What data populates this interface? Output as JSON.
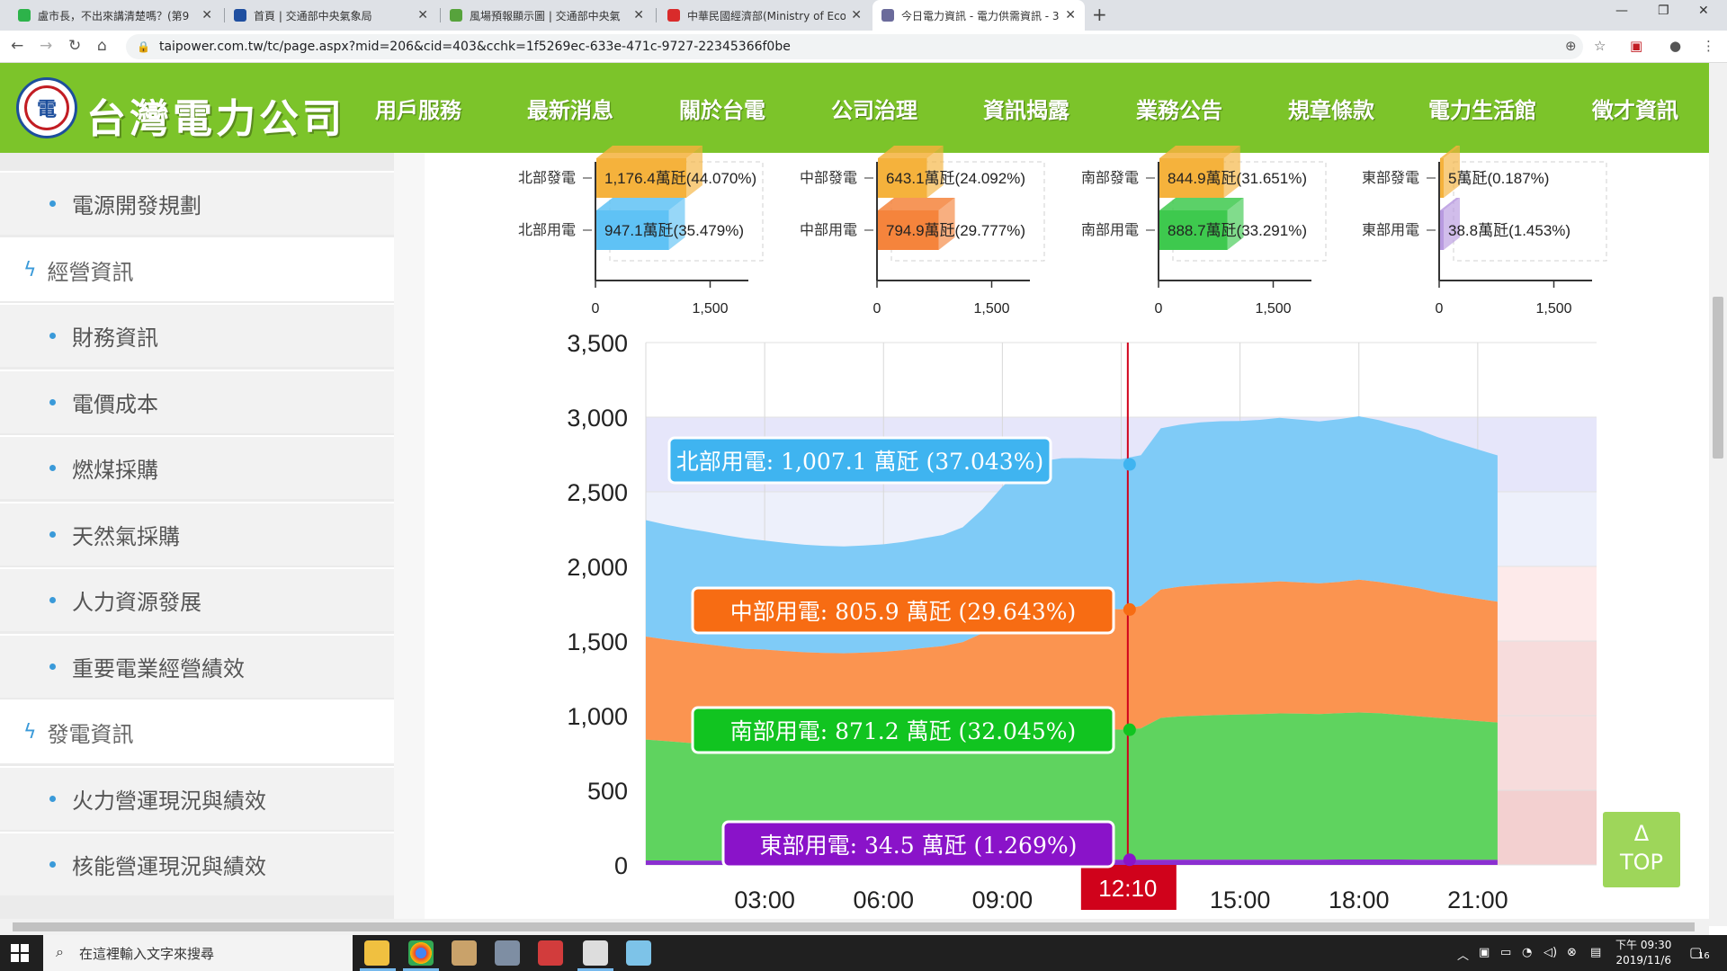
{
  "browser": {
    "tabs": [
      {
        "title": "盧市長，不出來講清楚嗎？(第9",
        "color": "#2db34a",
        "active": false
      },
      {
        "title": "首頁 | 交通部中央氣象局",
        "color": "#1f4fa0",
        "active": false
      },
      {
        "title": "風場預報顯示圖 | 交通部中央氣",
        "color": "#57a33c",
        "active": false
      },
      {
        "title": "中華民國經濟部(Ministry of Eco",
        "color": "#d92b2b",
        "active": false
      },
      {
        "title": "今日電力資訊 - 電力供需資訊 - 3",
        "color": "#6b6b9b",
        "active": true
      }
    ],
    "new_tab": "+",
    "close": "✕",
    "url": "taipower.com.tw/tc/page.aspx?mid=206&cid=403&cchk=1f5269ec-633e-471c-9727-22345366f0be"
  },
  "site": {
    "brand": "台灣電力公司",
    "nav": [
      "用戶服務",
      "最新消息",
      "關於台電",
      "公司治理",
      "資訊揭露",
      "業務公告",
      "規章條款",
      "電力生活館",
      "徵才資訊"
    ]
  },
  "sidebar": {
    "items": [
      {
        "label": "電源開發規劃",
        "type": "sub"
      },
      {
        "label": "經營資訊",
        "type": "section"
      },
      {
        "label": "財務資訊",
        "type": "sub"
      },
      {
        "label": "電價成本",
        "type": "sub"
      },
      {
        "label": "燃煤採購",
        "type": "sub"
      },
      {
        "label": "天然氣採購",
        "type": "sub"
      },
      {
        "label": "人力資源發展",
        "type": "sub"
      },
      {
        "label": "重要電業經營績效",
        "type": "sub"
      },
      {
        "label": "發電資訊",
        "type": "section"
      },
      {
        "label": "火力營運現況與績效",
        "type": "sub"
      },
      {
        "label": "核能營運現況與績效",
        "type": "sub"
      }
    ]
  },
  "chart_data": [
    {
      "type": "bar",
      "panels": [
        {
          "labels": [
            "北部發電",
            "北部用電"
          ],
          "values": [
            1176.4,
            947.1
          ],
          "texts": [
            "1,176.4萬瓩(44.070%)",
            "947.1萬瓩(35.479%)"
          ],
          "colors": [
            "#f5b23c",
            "#5fc2f5"
          ]
        },
        {
          "labels": [
            "中部發電",
            "中部用電"
          ],
          "values": [
            643.1,
            794.9
          ],
          "texts": [
            "643.1萬瓩(24.092%)",
            "794.9萬瓩(29.777%)"
          ],
          "colors": [
            "#f5b23c",
            "#f5843c"
          ]
        },
        {
          "labels": [
            "南部發電",
            "南部用電"
          ],
          "values": [
            844.9,
            888.7
          ],
          "texts": [
            "844.9萬瓩(31.651%)",
            "888.7萬瓩(33.291%)"
          ],
          "colors": [
            "#f5b23c",
            "#3ec94e"
          ]
        },
        {
          "labels": [
            "東部發電",
            "東部用電"
          ],
          "values": [
            5,
            38.8
          ],
          "texts": [
            "5萬瓩(0.187%)",
            "38.8萬瓩(1.453%)"
          ],
          "colors": [
            "#f5b23c",
            "#b89ae0"
          ]
        }
      ],
      "xlim": [
        0,
        2000
      ],
      "ticks": [
        0,
        1500
      ],
      "tick_labels": [
        "0",
        "1,500"
      ]
    },
    {
      "type": "area",
      "stacked": true,
      "ylim": [
        0,
        3500
      ],
      "yticks": [
        0,
        500,
        1000,
        1500,
        2000,
        2500,
        3000,
        3500
      ],
      "ytick_labels": [
        "0",
        "500",
        "1,000",
        "1,500",
        "2,000",
        "2,500",
        "3,000",
        "3,500"
      ],
      "xlim": [
        0,
        24
      ],
      "xticks": [
        3,
        6,
        9,
        15,
        18,
        21
      ],
      "xtick_labels": [
        "03:00",
        "06:00",
        "09:00",
        "15:00",
        "18:00",
        "21:00"
      ],
      "current_time": "12:10",
      "current_x": 12.1667,
      "bands": [
        {
          "from": 3000,
          "to": 3500,
          "color": "#ffffff"
        },
        {
          "from": 2500,
          "to": 3000,
          "color": "#e6e6fa"
        },
        {
          "from": 2000,
          "to": 2500,
          "color": "#edf0fb"
        },
        {
          "from": 1500,
          "to": 2000,
          "color": "#fdeaea"
        },
        {
          "from": 500,
          "to": 1500,
          "color": "#f7dcdc"
        },
        {
          "from": 0,
          "to": 500,
          "color": "#f3d0d0"
        }
      ],
      "x": [
        0,
        0.5,
        1,
        1.5,
        2,
        2.5,
        3,
        3.5,
        4,
        4.5,
        5,
        5.5,
        6,
        6.5,
        7,
        7.5,
        8,
        8.5,
        9,
        9.5,
        10,
        10.5,
        11,
        11.5,
        12,
        12.5,
        13,
        13.5,
        14,
        14.5,
        15,
        15.5,
        16,
        16.5,
        17,
        17.5,
        18,
        18.5,
        19,
        19.5,
        20,
        20.5,
        21,
        21.5
      ],
      "series": [
        {
          "name": "東部用電",
          "color": "#8b2fd0",
          "values": [
            30,
            30,
            29,
            29,
            29,
            28,
            28,
            28,
            28,
            28,
            28,
            28,
            28,
            29,
            30,
            31,
            32,
            33,
            34,
            34,
            35,
            35,
            35,
            35,
            35,
            35,
            35,
            35,
            35,
            35,
            35,
            35,
            35,
            35,
            35,
            36,
            36,
            36,
            36,
            35,
            35,
            35,
            34,
            34
          ]
        },
        {
          "name": "南部用電",
          "color": "#5fd35f",
          "values": [
            810,
            800,
            790,
            780,
            770,
            760,
            755,
            750,
            745,
            742,
            740,
            742,
            745,
            750,
            755,
            760,
            770,
            800,
            840,
            870,
            880,
            885,
            880,
            875,
            871,
            880,
            950,
            960,
            965,
            970,
            972,
            975,
            980,
            978,
            975,
            980,
            985,
            980,
            970,
            960,
            950,
            940,
            930,
            920
          ]
        },
        {
          "name": "中部用電",
          "color": "#fb9450",
          "values": [
            690,
            680,
            675,
            670,
            665,
            660,
            660,
            655,
            652,
            650,
            650,
            652,
            655,
            660,
            668,
            675,
            690,
            720,
            760,
            790,
            800,
            805,
            806,
            806,
            806,
            820,
            860,
            870,
            875,
            878,
            880,
            882,
            885,
            880,
            876,
            880,
            890,
            880,
            870,
            860,
            840,
            830,
            820,
            810
          ]
        },
        {
          "name": "北部用電",
          "color": "#7fcbf7",
          "values": [
            780,
            770,
            760,
            755,
            745,
            740,
            730,
            725,
            720,
            718,
            716,
            718,
            720,
            725,
            735,
            745,
            770,
            830,
            900,
            960,
            990,
            1000,
            1005,
            1006,
            1007,
            1010,
            1080,
            1085,
            1090,
            1090,
            1088,
            1090,
            1095,
            1090,
            1085,
            1090,
            1095,
            1085,
            1070,
            1060,
            1040,
            1020,
            1000,
            980
          ]
        }
      ],
      "tooltips": [
        {
          "text": "北部用電: 1,007.1 萬瓩 (37.043%)",
          "value": 2683.7,
          "color": "#3fb4f0"
        },
        {
          "text": "中部用電: 805.9 萬瓩 (29.643%)",
          "value": 1711.4,
          "color": "#f76c13"
        },
        {
          "text": "南部用電: 871.2 萬瓩 (32.045%)",
          "value": 905.7,
          "color": "#11c420"
        },
        {
          "text": "東部用電: 34.5 萬瓩 (1.269%)",
          "value": 34.5,
          "color": "#8a13c9"
        }
      ]
    }
  ],
  "top_button": {
    "arrow": "Δ",
    "label": "TOP"
  },
  "taskbar": {
    "search_placeholder": "在這裡輸入文字來搜尋",
    "time": "下午 09:30",
    "date": "2019/11/6",
    "notif": "16"
  }
}
